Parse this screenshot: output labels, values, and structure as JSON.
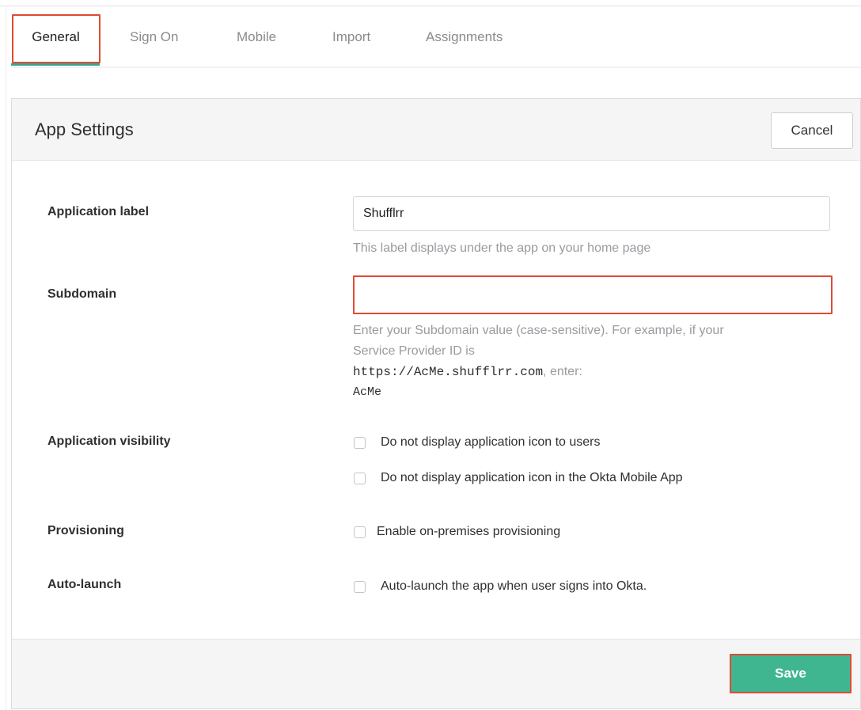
{
  "tabs": [
    {
      "label": "General",
      "active": true
    },
    {
      "label": "Sign On"
    },
    {
      "label": "Mobile"
    },
    {
      "label": "Import"
    },
    {
      "label": "Assignments"
    }
  ],
  "panel": {
    "title": "App Settings",
    "cancel_label": "Cancel",
    "save_label": "Save"
  },
  "fields": {
    "application_label": {
      "label": "Application label",
      "value": "Shufflrr",
      "help": "This label displays under the app on your home page"
    },
    "subdomain": {
      "label": "Subdomain",
      "value": "",
      "help_line1": "Enter your Subdomain value (case-sensitive). For example, if your",
      "help_line2": "Service Provider ID is",
      "help_url": "https://AcMe.shufflrr.com",
      "help_enter": ", enter:",
      "help_example": "AcMe"
    },
    "visibility": {
      "label": "Application visibility",
      "options": [
        {
          "label": "Do not display application icon to users",
          "checked": false
        },
        {
          "label": "Do not display application icon in the Okta Mobile App",
          "checked": false
        }
      ]
    },
    "provisioning": {
      "label": "Provisioning",
      "option": {
        "label": "Enable on-premises provisioning",
        "checked": false
      }
    },
    "auto_launch": {
      "label": "Auto-launch",
      "option": {
        "label": "Auto-launch the app when user signs into Okta.",
        "checked": false
      }
    }
  },
  "colors": {
    "accent": "#3fb68f",
    "highlight": "#e04a35",
    "tab_underline": "#3aa68e"
  }
}
